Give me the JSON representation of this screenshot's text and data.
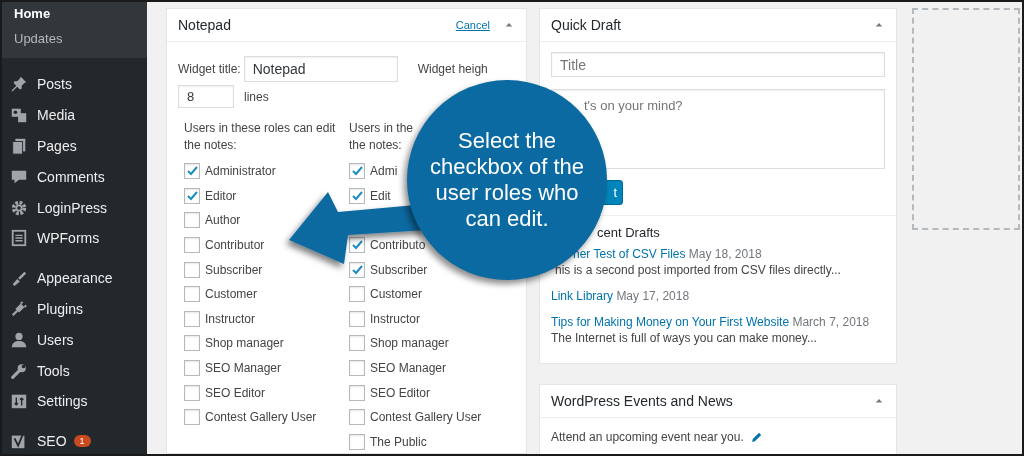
{
  "sidebar": {
    "submenu": [
      {
        "label": "Home",
        "selected": true
      },
      {
        "label": "Updates",
        "selected": false
      }
    ],
    "groups": [
      {
        "items": [
          {
            "label": "Posts"
          },
          {
            "label": "Media"
          },
          {
            "label": "Pages"
          },
          {
            "label": "Comments"
          },
          {
            "label": "LoginPress"
          },
          {
            "label": "WPForms"
          }
        ]
      },
      {
        "items": [
          {
            "label": "Appearance"
          },
          {
            "label": "Plugins"
          },
          {
            "label": "Users"
          },
          {
            "label": "Tools"
          },
          {
            "label": "Settings"
          }
        ]
      },
      {
        "items": [
          {
            "label": "SEO",
            "badge": "1"
          }
        ]
      }
    ]
  },
  "notepad": {
    "title": "Notepad",
    "cancel_link": "Cancel",
    "widget_title_label": "Widget title:",
    "widget_title_value": "Notepad",
    "widget_height_label": "Widget heigh",
    "height_value": "8",
    "lines_label": "lines",
    "role_columns": [
      {
        "heading": "Users in these roles can edit the notes:",
        "roles": [
          {
            "kind": "checkbox",
            "label": "Administrator",
            "checked": true
          },
          {
            "kind": "checkbox",
            "label": "Editor",
            "checked": true
          },
          {
            "kind": "checkbox",
            "label": "Author",
            "checked": false
          },
          {
            "kind": "checkbox",
            "label": "Contributor",
            "checked": false
          },
          {
            "kind": "checkbox",
            "label": "Subscriber",
            "checked": false
          },
          {
            "kind": "checkbox",
            "label": "Customer",
            "checked": false
          },
          {
            "kind": "checkbox",
            "label": "Instructor",
            "checked": false
          },
          {
            "kind": "checkbox",
            "label": "Shop manager",
            "checked": false
          },
          {
            "kind": "checkbox",
            "label": "SEO Manager",
            "checked": false
          },
          {
            "kind": "checkbox",
            "label": "SEO Editor",
            "checked": false
          },
          {
            "kind": "checkbox",
            "label": "Contest Gallery User",
            "checked": false
          }
        ]
      },
      {
        "heading_lines": [
          "Users in the",
          "the notes:"
        ],
        "roles": [
          {
            "kind": "checkbox",
            "label": "Admi",
            "checked": true
          },
          {
            "kind": "checkbox",
            "label": "Edit",
            "checked": true
          },
          {
            "kind": "covered"
          },
          {
            "kind": "checkbox",
            "label": "Contributo",
            "checked": true
          },
          {
            "kind": "checkbox",
            "label": "Subscriber",
            "checked": true
          },
          {
            "kind": "checkbox",
            "label": "Customer",
            "checked": false
          },
          {
            "kind": "checkbox",
            "label": "Instructor",
            "checked": false
          },
          {
            "kind": "checkbox",
            "label": "Shop manager",
            "checked": false
          },
          {
            "kind": "checkbox",
            "label": "SEO Manager",
            "checked": false
          },
          {
            "kind": "checkbox",
            "label": "SEO Editor",
            "checked": false
          },
          {
            "kind": "checkbox",
            "label": "Contest Gallery User",
            "checked": false
          },
          {
            "kind": "checkbox",
            "label": "The Public",
            "checked": false
          }
        ]
      }
    ]
  },
  "quick_draft": {
    "title": "Quick Draft",
    "title_placeholder": "Title",
    "content_placeholder": "t's on your mind?",
    "button": "t",
    "drafts_heading": "cent Drafts",
    "drafts": [
      {
        "title": "her Test of CSV Files",
        "date": "May 18, 2018",
        "excerpt": "his is a second post imported from CSV files directly..."
      },
      {
        "title": "Link Library",
        "date": "May 17, 2018"
      },
      {
        "title": "Tips for Making Money on Your First Website",
        "date": "March 7, 2018",
        "excerpt": "The Internet is full of ways you can make money..."
      }
    ]
  },
  "events": {
    "title": "WordPress Events and News",
    "text": "Attend an upcoming event near you."
  },
  "callout": {
    "text": "Select the checkbox of the user roles who can edit."
  }
}
